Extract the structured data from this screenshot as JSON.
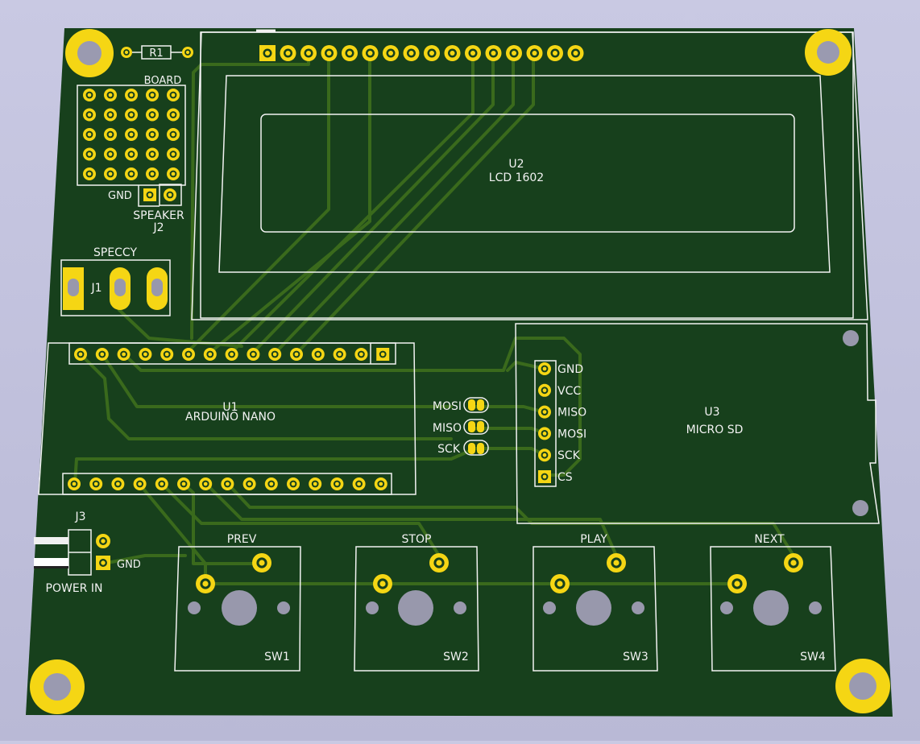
{
  "colors": {
    "background": "#c4c4de",
    "board": "#17401c",
    "trace": "#3a6a1c",
    "silkscreen": "#f2f2f2",
    "copper": "#f5d614",
    "drill": "#9898ac"
  },
  "labels": {
    "r1": "R1",
    "board_header": "BOARD",
    "gnd_speaker": "GND",
    "speaker": "SPEAKER",
    "j2": "J2",
    "speccy": "SPECCY",
    "j1": "J1",
    "u2_ref": "U2",
    "u2_value": "LCD 1602",
    "u1_ref": "U1",
    "u1_value": "ARDUINO NANO",
    "mosi_jumper": "MOSI",
    "miso_jumper": "MISO",
    "sck_jumper": "SCK",
    "u3_ref": "U3",
    "u3_value": "MICRO SD",
    "sd_pins": [
      "GND",
      "VCC",
      "MISO",
      "MOSI",
      "SCK",
      "CS"
    ],
    "j3": "J3",
    "gnd_power": "GND",
    "power_in": "POWER IN",
    "switches": [
      {
        "action": "PREV",
        "ref": "SW1"
      },
      {
        "action": "STOP",
        "ref": "SW2"
      },
      {
        "action": "PLAY",
        "ref": "SW3"
      },
      {
        "action": "NEXT",
        "ref": "SW4"
      }
    ]
  }
}
